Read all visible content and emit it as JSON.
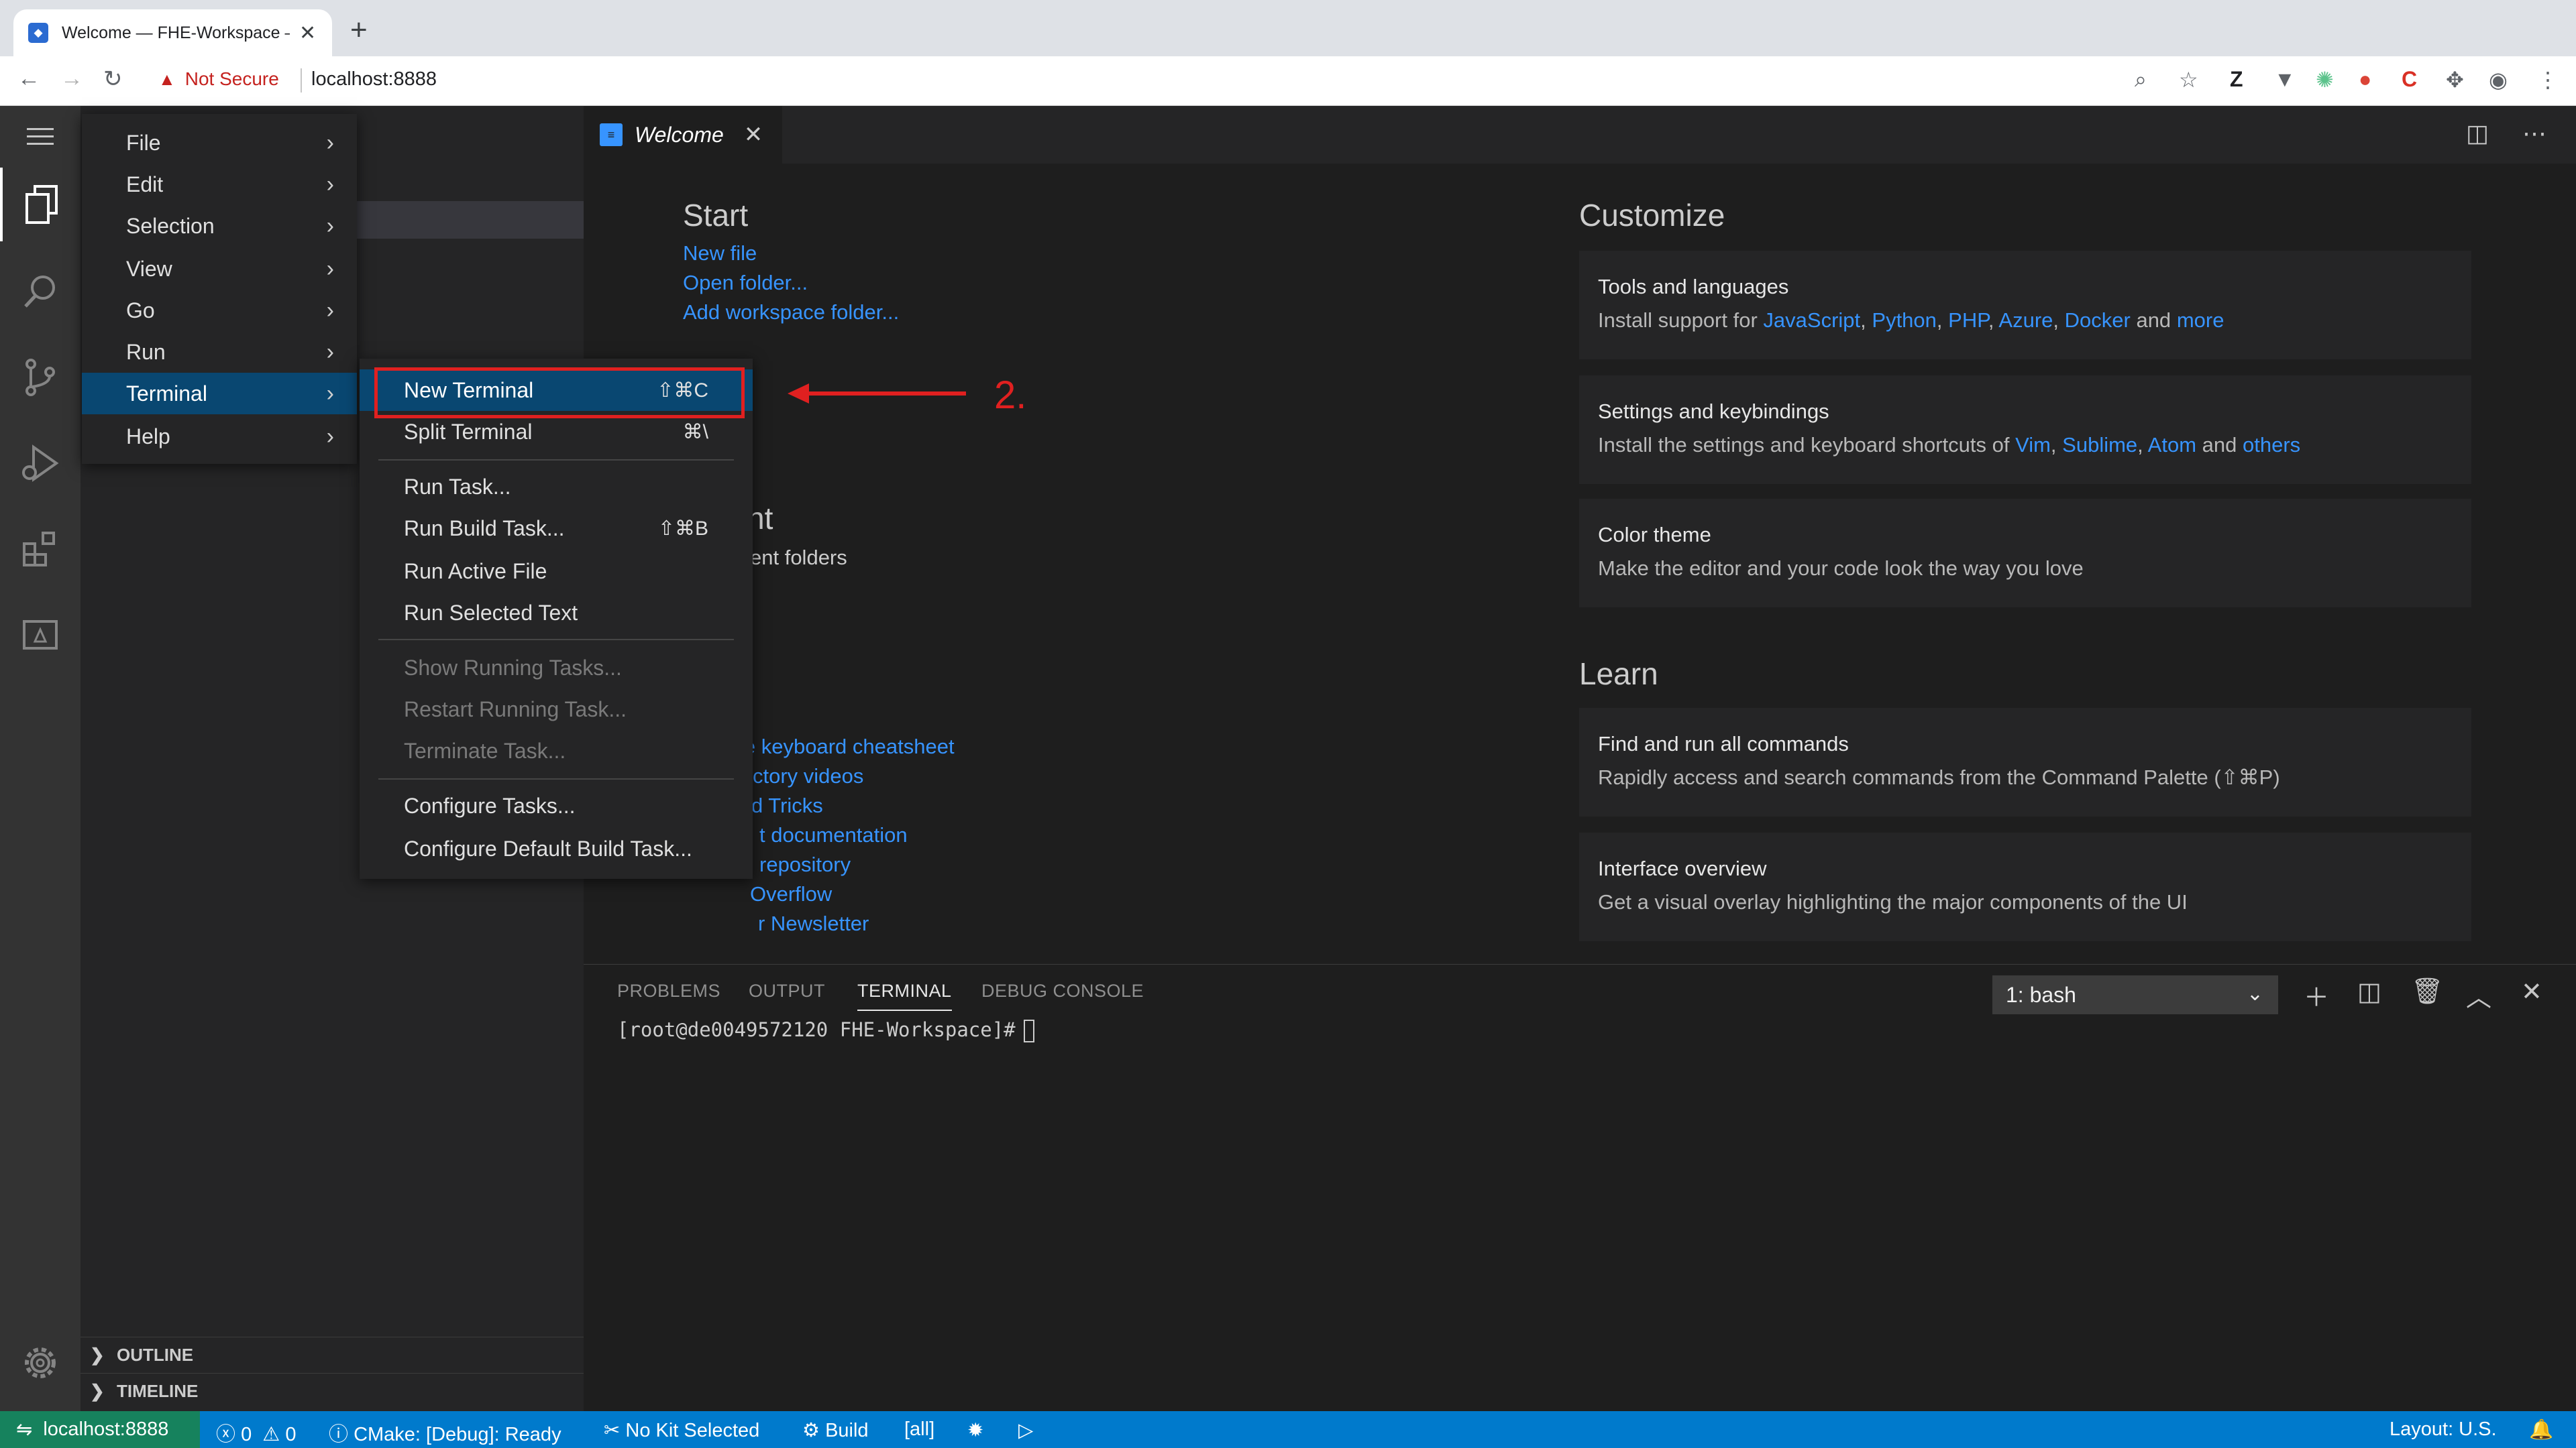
{
  "browser": {
    "tab_title": "Welcome — FHE-Workspace — ...",
    "not_secure": "Not Secure",
    "url": "localhost:8888",
    "new_tab": "+",
    "tab_close": "✕"
  },
  "editor": {
    "tab_label": "Welcome",
    "tab_close": "✕"
  },
  "welcome": {
    "start": {
      "title": "Start",
      "links": [
        "New file",
        "Open folder...",
        "Add workspace folder..."
      ]
    },
    "recent": {
      "title_fragment": "nt",
      "subtitle_fragment": "ent folders"
    },
    "help_links_fragments": [
      "le keyboard cheatsheet",
      "ctory videos",
      "d Tricks",
      "t documentation",
      " repository",
      "Overflow",
      "r Newsletter"
    ],
    "customize": {
      "title": "Customize",
      "cards": [
        {
          "title": "Tools and languages",
          "desc": "Install support for",
          "links": [
            "JavaScript",
            "Python",
            "PHP",
            "Azure",
            "Docker"
          ],
          "tail_and": "and",
          "tail_link": "more"
        },
        {
          "title": "Settings and keybindings",
          "desc": "Install the settings and keyboard shortcuts of",
          "links": [
            "Vim",
            "Sublime",
            "Atom"
          ],
          "tail_and": "and",
          "tail_link": "others"
        },
        {
          "title": "Color theme",
          "desc": "Make the editor and your code look the way you love"
        }
      ]
    },
    "learn": {
      "title": "Learn",
      "cards": [
        {
          "title": "Find and run all commands",
          "desc": "Rapidly access and search commands from the Command Palette (⇧⌘P)"
        },
        {
          "title": "Interface overview",
          "desc": "Get a visual overlay highlighting the major components of the UI"
        }
      ]
    }
  },
  "panel": {
    "tabs": [
      "PROBLEMS",
      "OUTPUT",
      "TERMINAL",
      "DEBUG CONSOLE"
    ],
    "active_tab": "TERMINAL",
    "terminal_select": "1: bash",
    "prompt": "[root@de0049572120 FHE-Workspace]#"
  },
  "sidebar": {
    "sections": [
      "OUTLINE",
      "TIMELINE"
    ]
  },
  "main_menu": {
    "items": [
      "File",
      "Edit",
      "Selection",
      "View",
      "Go",
      "Run",
      "Terminal",
      "Help"
    ],
    "active": "Terminal"
  },
  "terminal_menu": {
    "items": [
      {
        "label": "New Terminal",
        "shortcut": "⇧⌘C"
      },
      {
        "label": "Split Terminal",
        "shortcut": "⌘\\"
      },
      {
        "label": "Run Task...",
        "shortcut": ""
      },
      {
        "label": "Run Build Task...",
        "shortcut": "⇧⌘B"
      },
      {
        "label": "Run Active File",
        "shortcut": ""
      },
      {
        "label": "Run Selected Text",
        "shortcut": ""
      },
      {
        "label": "Show Running Tasks...",
        "shortcut": ""
      },
      {
        "label": "Restart Running Task...",
        "shortcut": ""
      },
      {
        "label": "Terminate Task...",
        "shortcut": ""
      },
      {
        "label": "Configure Tasks...",
        "shortcut": ""
      },
      {
        "label": "Configure Default Build Task...",
        "shortcut": ""
      }
    ]
  },
  "annotation": {
    "label": "2.",
    "color": "#e02020"
  },
  "statusbar": {
    "remote": "localhost:8888",
    "errors": "0",
    "warnings": "0",
    "cmake": "CMake: [Debug]: Ready",
    "kit": "No Kit Selected",
    "build": "Build",
    "target": "[all]",
    "layout": "Layout: U.S."
  },
  "colors": {
    "accent": "#007acc",
    "remote": "#16825d",
    "link": "#3794ff",
    "menu_selection": "#094771"
  }
}
